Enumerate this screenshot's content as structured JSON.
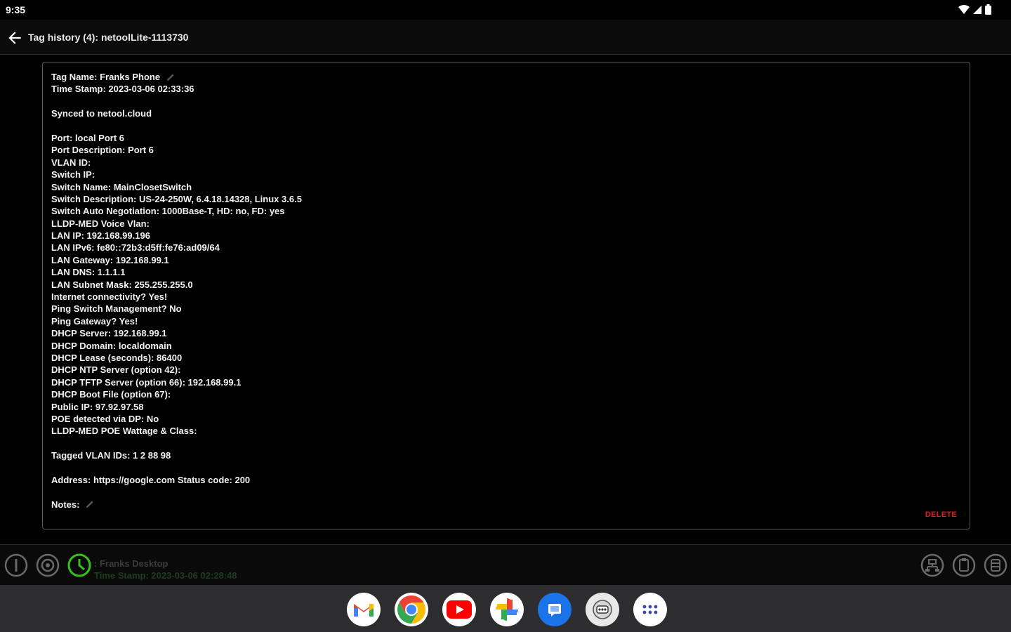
{
  "status_bar": {
    "time": "9:35"
  },
  "header": {
    "title": "Tag history (4): netoolLite-1113730"
  },
  "entry": {
    "tag_name": "Tag Name: Franks Phone",
    "time_stamp": "Time Stamp: 2023-03-06 02:33:36",
    "synced": "Synced to netool.cloud",
    "details": [
      "Port: local Port 6",
      "Port Description: Port 6",
      "VLAN ID:",
      "Switch IP:",
      "Switch Name: MainClosetSwitch",
      "Switch Description: US-24-250W, 6.4.18.14328, Linux 3.6.5",
      "Switch Auto Negotiation: 1000Base-T, HD: no, FD: yes",
      "LLDP-MED Voice Vlan:",
      "LAN IP: 192.168.99.196",
      "LAN IPv6: fe80::72b3:d5ff:fe76:ad09/64",
      "LAN Gateway: 192.168.99.1",
      "LAN DNS: 1.1.1.1",
      "LAN Subnet Mask: 255.255.255.0",
      "Internet connectivity? Yes!",
      "Ping Switch Management? No",
      "Ping Gateway? Yes!",
      "DHCP Server: 192.168.99.1",
      "DHCP Domain: localdomain",
      "DHCP Lease (seconds): 86400",
      "DHCP NTP Server (option 42):",
      "DHCP TFTP Server (option 66): 192.168.99.1",
      "DHCP Boot File (option 67):",
      "Public IP: 97.92.97.58",
      "POE detected via DP: No",
      "LLDP-MED POE Wattage & Class:"
    ],
    "tagged_vlans": "Tagged VLAN IDs: 1 2 88 98",
    "address": "Address: https://google.com Status code: 200",
    "notes": "Notes:",
    "delete_label": "DELETE"
  },
  "next_entry_peek": {
    "tag_name": ": Franks Desktop",
    "time_stamp": "Time Stamp: 2023-03-06 02:28:48"
  },
  "bottom_bar": {
    "left_icons": [
      "info-icon",
      "target-icon",
      "history-clock-icon"
    ],
    "right_icons": [
      "network-icon",
      "clipboard-icon",
      "storage-icon"
    ]
  },
  "dock": {
    "apps": [
      "gmail-icon",
      "chrome-icon",
      "youtube-icon",
      "photos-icon",
      "messages-icon",
      "netool-icon",
      "app-drawer-icon"
    ]
  },
  "colors": {
    "background": "#000000",
    "delete": "#e21b1b",
    "active_accent": "#36c21a",
    "taskbar": "#2d2d30"
  }
}
